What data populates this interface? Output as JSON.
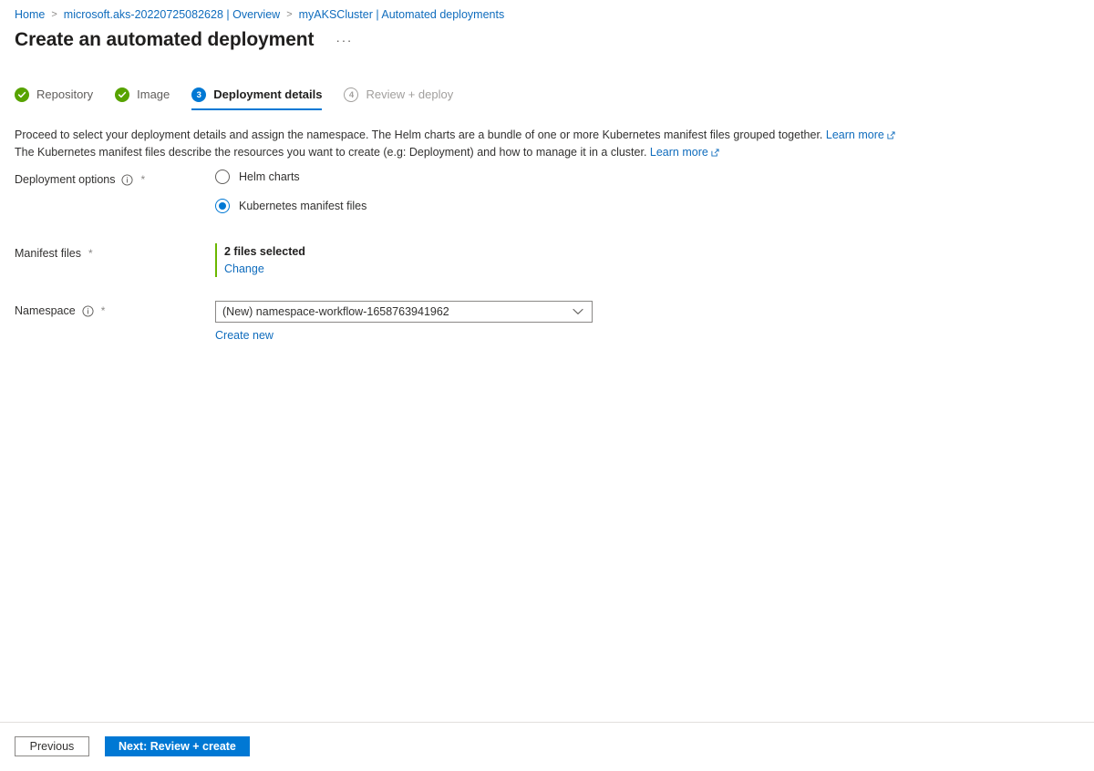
{
  "breadcrumb": {
    "items": [
      {
        "label": "Home"
      },
      {
        "label": "microsoft.aks-20220725082628 | Overview"
      },
      {
        "label": "myAKSCluster | Automated deployments"
      }
    ],
    "separator": ">"
  },
  "header": {
    "title": "Create an automated deployment",
    "overflow_label": "···"
  },
  "steps": [
    {
      "label": "Repository",
      "number": "1",
      "state": "done"
    },
    {
      "label": "Image",
      "number": "2",
      "state": "done"
    },
    {
      "label": "Deployment details",
      "number": "3",
      "state": "active"
    },
    {
      "label": "Review + deploy",
      "number": "4",
      "state": "todo"
    }
  ],
  "description": {
    "line1_text": "Proceed to select your deployment details and assign the namespace. The Helm charts are a bundle of one or more Kubernetes manifest files grouped together.",
    "line1_link": "Learn more",
    "line2_text": "The Kubernetes manifest files describe the resources you want to create (e.g: Deployment) and how to manage it in a cluster.",
    "line2_link": "Learn more"
  },
  "form": {
    "deployment_options": {
      "label": "Deployment options",
      "required_marker": "*",
      "info_icon": "info-icon",
      "options": [
        {
          "label": "Helm charts",
          "selected": false
        },
        {
          "label": "Kubernetes manifest files",
          "selected": true
        }
      ]
    },
    "manifest_files": {
      "label": "Manifest files",
      "required_marker": "*",
      "summary": "2 files selected",
      "change_link": "Change",
      "accent_color": "#6bb700"
    },
    "namespace": {
      "label": "Namespace",
      "required_marker": "*",
      "info_icon": "info-icon",
      "value": "(New) namespace-workflow-1658763941962",
      "create_new_link": "Create new"
    }
  },
  "footer": {
    "previous_label": "Previous",
    "next_label": "Next: Review + create"
  },
  "colors": {
    "accent_blue": "#0078d4",
    "link_blue": "#0f6cbd",
    "success_green": "#57a300",
    "manifest_green": "#6bb700"
  }
}
